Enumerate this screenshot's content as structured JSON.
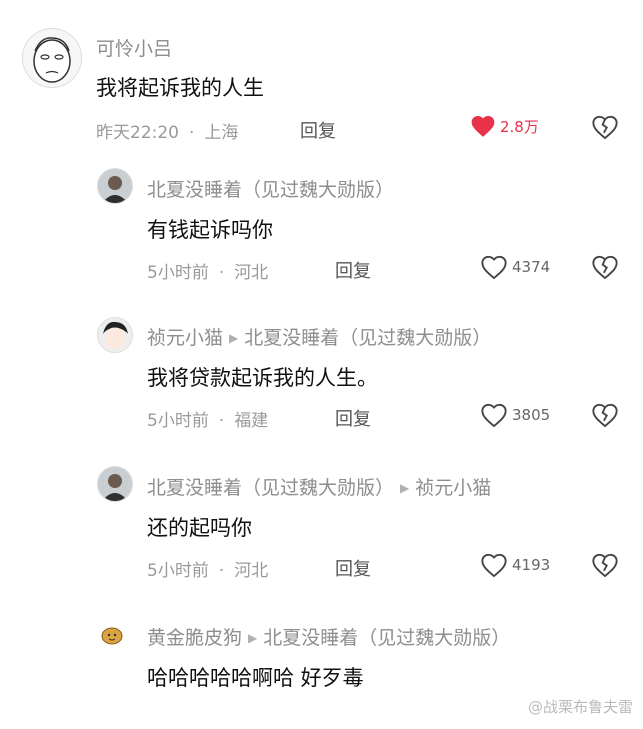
{
  "comments": [
    {
      "user": "可怜小吕",
      "text": "我将起诉我的人生",
      "time": "昨天22:20",
      "location": "上海",
      "reply_label": "回复",
      "likes": "2.8万",
      "liked": true
    },
    {
      "user": "北夏没睡着（见过魏大勋版）",
      "text": "有钱起诉吗你",
      "time": "5小时前",
      "location": "河北",
      "reply_label": "回复",
      "likes": "4374",
      "liked": false
    },
    {
      "user": "祯元小猫",
      "reply_to": "北夏没睡着（见过魏大勋版）",
      "text": "我将贷款起诉我的人生。",
      "time": "5小时前",
      "location": "福建",
      "reply_label": "回复",
      "likes": "3805",
      "liked": false
    },
    {
      "user": "北夏没睡着（见过魏大勋版）",
      "reply_to": "祯元小猫",
      "text": "还的起吗你",
      "time": "5小时前",
      "location": "河北",
      "reply_label": "回复",
      "likes": "4193",
      "liked": false
    },
    {
      "user": "黄金脆皮狗",
      "reply_to": "北夏没睡着（见过魏大勋版）",
      "text": "哈哈哈哈哈啊哈 好歹毒"
    }
  ],
  "watermark": "@战栗布鲁夫雷",
  "colors": {
    "like_active": "#e8324a",
    "meta": "#9a9a9a",
    "username": "#8e8e8e"
  },
  "icons": {
    "like": "heart-icon",
    "dislike": "broken-heart-icon"
  }
}
